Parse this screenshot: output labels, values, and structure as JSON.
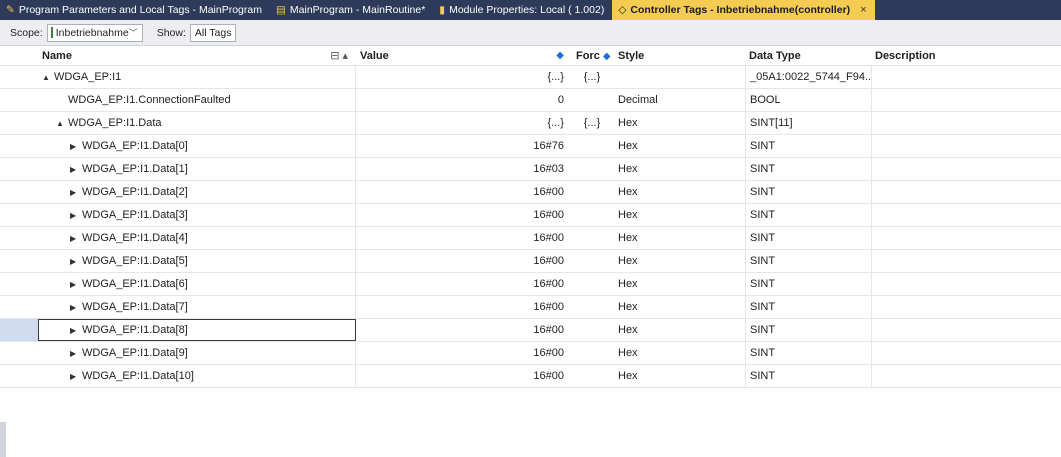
{
  "tabs": [
    {
      "label": "Program Parameters and Local Tags - MainProgram",
      "icon": "pencil-tag-icon",
      "active": false
    },
    {
      "label": "MainProgram - MainRoutine*",
      "icon": "ladder-routine-icon",
      "active": false
    },
    {
      "label": "Module Properties: Local ( 1.002)",
      "icon": "module-icon",
      "active": false
    },
    {
      "label": "Controller Tags - Inbetriebnahme(controller)",
      "icon": "tag-icon",
      "active": true,
      "close": "×"
    }
  ],
  "toolbar": {
    "scope_label": "Scope:",
    "scope_value": "Inbetriebnahme",
    "show_label": "Show:",
    "show_value": "All Tags"
  },
  "columns": {
    "name": "Name",
    "value": "Value",
    "forc": "Forc",
    "style": "Style",
    "data_type": "Data Type",
    "description": "Description"
  },
  "rows": [
    {
      "name": "WDGA_EP:I1",
      "indent": 0,
      "expander": "▲",
      "value": "{...}",
      "forc": "{...}",
      "style": "",
      "type": "_05A1:0022_5744_F94..."
    },
    {
      "name": "WDGA_EP:I1.ConnectionFaulted",
      "indent": 1,
      "expander": "",
      "value": "0",
      "forc": "",
      "style": "Decimal",
      "type": "BOOL"
    },
    {
      "name": "WDGA_EP:I1.Data",
      "indent": 1,
      "expander": "▲",
      "value": "{...}",
      "forc": "{...}",
      "style": "Hex",
      "type": "SINT[11]"
    },
    {
      "name": "WDGA_EP:I1.Data[0]",
      "indent": 2,
      "expander": "▶",
      "value": "16#76",
      "forc": "",
      "style": "Hex",
      "type": "SINT"
    },
    {
      "name": "WDGA_EP:I1.Data[1]",
      "indent": 2,
      "expander": "▶",
      "value": "16#03",
      "forc": "",
      "style": "Hex",
      "type": "SINT"
    },
    {
      "name": "WDGA_EP:I1.Data[2]",
      "indent": 2,
      "expander": "▶",
      "value": "16#00",
      "forc": "",
      "style": "Hex",
      "type": "SINT"
    },
    {
      "name": "WDGA_EP:I1.Data[3]",
      "indent": 2,
      "expander": "▶",
      "value": "16#00",
      "forc": "",
      "style": "Hex",
      "type": "SINT"
    },
    {
      "name": "WDGA_EP:I1.Data[4]",
      "indent": 2,
      "expander": "▶",
      "value": "16#00",
      "forc": "",
      "style": "Hex",
      "type": "SINT"
    },
    {
      "name": "WDGA_EP:I1.Data[5]",
      "indent": 2,
      "expander": "▶",
      "value": "16#00",
      "forc": "",
      "style": "Hex",
      "type": "SINT"
    },
    {
      "name": "WDGA_EP:I1.Data[6]",
      "indent": 2,
      "expander": "▶",
      "value": "16#00",
      "forc": "",
      "style": "Hex",
      "type": "SINT"
    },
    {
      "name": "WDGA_EP:I1.Data[7]",
      "indent": 2,
      "expander": "▶",
      "value": "16#00",
      "forc": "",
      "style": "Hex",
      "type": "SINT"
    },
    {
      "name": "WDGA_EP:I1.Data[8]",
      "indent": 2,
      "expander": "▶",
      "value": "16#00",
      "forc": "",
      "style": "Hex",
      "type": "SINT",
      "selected": true
    },
    {
      "name": "WDGA_EP:I1.Data[9]",
      "indent": 2,
      "expander": "▶",
      "value": "16#00",
      "forc": "",
      "style": "Hex",
      "type": "SINT"
    },
    {
      "name": "WDGA_EP:I1.Data[10]",
      "indent": 2,
      "expander": "▶",
      "value": "16#00",
      "forc": "",
      "style": "Hex",
      "type": "SINT"
    }
  ],
  "colors": {
    "tab_bar": "#2d3a5a",
    "active_tab": "#f5cc52",
    "selection": "#cfdcf0",
    "sort_arrow": "#1e6fd9"
  }
}
